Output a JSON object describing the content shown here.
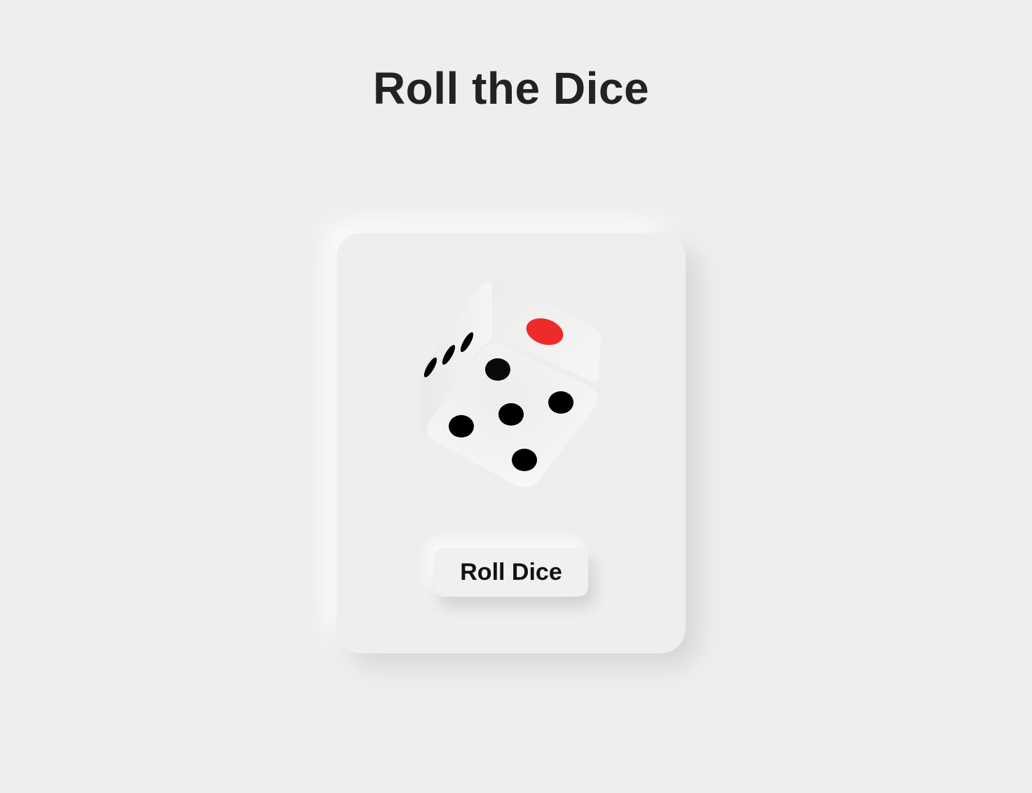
{
  "page": {
    "title": "Roll the Dice"
  },
  "dice": {
    "front_face_value": 5,
    "top_face_value": 1,
    "side_face_value": 3,
    "pip_color": "#000000",
    "top_pip_color": "#ee2b2b",
    "body_color": "#f4f4f2"
  },
  "controls": {
    "roll_label": "Roll Dice"
  },
  "colors": {
    "background": "#eeeeee",
    "title": "#222222",
    "button_text": "#111111"
  }
}
